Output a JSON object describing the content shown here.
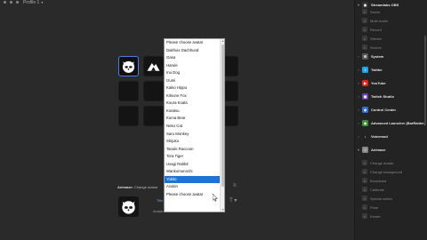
{
  "topbar": {
    "profile_label": "Profile 1"
  },
  "inspector": {
    "action_name": "Animaze:",
    "action_desc": "Change avatar",
    "title_label": "Title",
    "avatar_label": "Avatar"
  },
  "dropdown": {
    "items": [
      "Please choose avatar",
      "Dakhuis Dachhund",
      "Gasa",
      "Harule",
      "Inu Dog",
      "Izumi",
      "Kaiko Hippo",
      "Kitsune Fox",
      "Koura Koala",
      "Kotatsu",
      "Kuma Bear",
      "Neko Cat",
      "Saru Monkey",
      "Shijuku",
      "Tanuki Raccoon",
      "Tora Tiger",
      "Usagi Rabbit",
      "Wankomonochi",
      "Yokito",
      "Azukin",
      "Please choose avatar"
    ],
    "selected_index": 18
  },
  "sidebar": {
    "rows": [
      {
        "kind": "cat",
        "label": "Streamlabs OBS",
        "icon": "streamlabs-icon",
        "color": "#333333",
        "expanded": true
      },
      {
        "kind": "sub",
        "label": "Scene",
        "icon": "scene-icon"
      },
      {
        "kind": "sub",
        "label": "Mute Audio",
        "icon": "mute-icon"
      },
      {
        "kind": "sub",
        "label": "Record",
        "icon": "record-icon"
      },
      {
        "kind": "sub",
        "label": "Stream",
        "icon": "stream-icon"
      },
      {
        "kind": "sub",
        "label": "Source",
        "icon": "source-icon"
      },
      {
        "kind": "cat",
        "label": "System",
        "icon": "system-icon",
        "color": "#555555"
      },
      {
        "kind": "cat",
        "label": "Twitter",
        "icon": "twitter-icon",
        "color": "#1da1f2"
      },
      {
        "kind": "cat",
        "label": "YouTube",
        "icon": "youtube-icon",
        "color": "#e62117"
      },
      {
        "kind": "cat",
        "label": "Twitch Studio",
        "icon": "twitch-icon",
        "color": "#6441a5"
      },
      {
        "kind": "cat",
        "label": "Control Center",
        "icon": "control-center-icon",
        "color": "#2d6fd6"
      },
      {
        "kind": "cat",
        "label": "Advanced Launcher (BarRaider)",
        "icon": "launcher-icon",
        "color": "#3b8f3b"
      },
      {
        "kind": "cat",
        "label": "Voicemod",
        "icon": "voicemod-icon",
        "color": "#222222"
      },
      {
        "kind": "cat",
        "label": "Animaze",
        "icon": "animaze-icon",
        "color": "#888888",
        "expanded": true
      },
      {
        "kind": "sub",
        "label": "Change avatar",
        "icon": "avatar-icon"
      },
      {
        "kind": "sub",
        "label": "Change background",
        "icon": "background-icon"
      },
      {
        "kind": "sub",
        "label": "Broadcast",
        "icon": "broadcast-icon"
      },
      {
        "kind": "sub",
        "label": "Calibrate",
        "icon": "calibrate-icon"
      },
      {
        "kind": "sub",
        "label": "Special action",
        "icon": "special-icon"
      },
      {
        "kind": "sub",
        "label": "Pose",
        "icon": "pose-icon"
      },
      {
        "kind": "sub",
        "label": "Emote",
        "icon": "emote-icon"
      }
    ]
  }
}
